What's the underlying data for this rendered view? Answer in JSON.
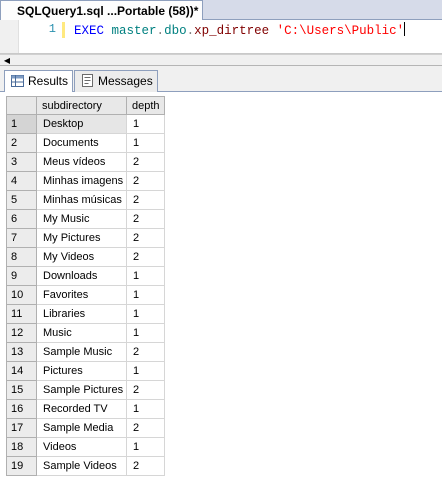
{
  "document_tab": {
    "title": "SQLQuery1.sql ...Portable (58))*"
  },
  "editor": {
    "line_number": "1",
    "code": {
      "exec": "EXEC",
      "db": "master",
      "dot1": ".",
      "schema": "dbo",
      "dot2": ".",
      "proc": "xp_dirtree",
      "arg": "'C:\\Users\\Public'"
    }
  },
  "result_tabs": [
    {
      "label": "Results",
      "icon": "grid-icon",
      "active": true
    },
    {
      "label": "Messages",
      "icon": "messages-icon",
      "active": false
    }
  ],
  "grid": {
    "columns": [
      "subdirectory",
      "depth"
    ],
    "rows": [
      {
        "n": "1",
        "subdirectory": "Desktop",
        "depth": "1"
      },
      {
        "n": "2",
        "subdirectory": "Documents",
        "depth": "1"
      },
      {
        "n": "3",
        "subdirectory": "Meus vídeos",
        "depth": "2"
      },
      {
        "n": "4",
        "subdirectory": "Minhas imagens",
        "depth": "2"
      },
      {
        "n": "5",
        "subdirectory": "Minhas músicas",
        "depth": "2"
      },
      {
        "n": "6",
        "subdirectory": "My Music",
        "depth": "2"
      },
      {
        "n": "7",
        "subdirectory": "My Pictures",
        "depth": "2"
      },
      {
        "n": "8",
        "subdirectory": "My Videos",
        "depth": "2"
      },
      {
        "n": "9",
        "subdirectory": "Downloads",
        "depth": "1"
      },
      {
        "n": "10",
        "subdirectory": "Favorites",
        "depth": "1"
      },
      {
        "n": "11",
        "subdirectory": "Libraries",
        "depth": "1"
      },
      {
        "n": "12",
        "subdirectory": "Music",
        "depth": "1"
      },
      {
        "n": "13",
        "subdirectory": "Sample Music",
        "depth": "2"
      },
      {
        "n": "14",
        "subdirectory": "Pictures",
        "depth": "1"
      },
      {
        "n": "15",
        "subdirectory": "Sample Pictures",
        "depth": "2"
      },
      {
        "n": "16",
        "subdirectory": "Recorded TV",
        "depth": "1"
      },
      {
        "n": "17",
        "subdirectory": "Sample Media",
        "depth": "2"
      },
      {
        "n": "18",
        "subdirectory": "Videos",
        "depth": "1"
      },
      {
        "n": "19",
        "subdirectory": "Sample Videos",
        "depth": "2"
      }
    ]
  }
}
